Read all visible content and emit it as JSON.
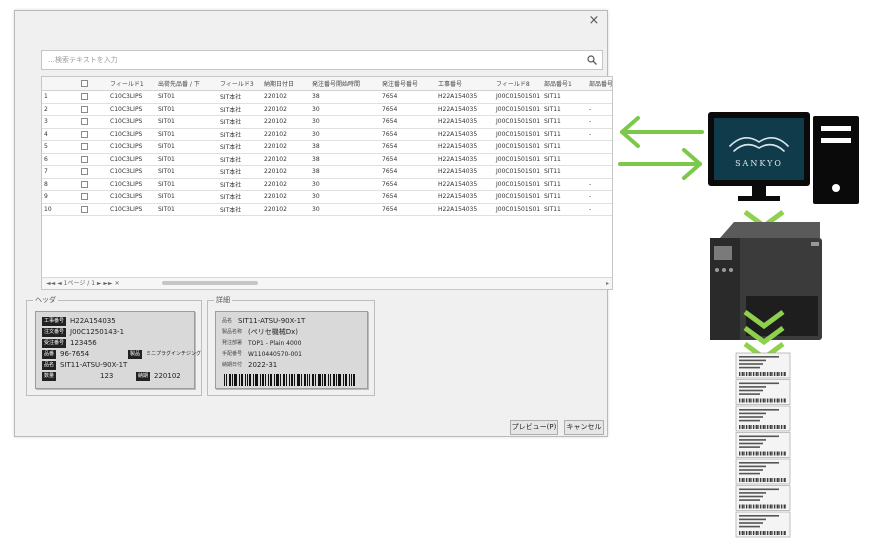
{
  "dialog": {
    "close_glyph": "×",
    "search_placeholder": "…検索テキストを入力",
    "columns": [
      "フィールド1",
      "出荷先品番 / 下",
      "フィールド3",
      "納期日付日",
      "発注番号開始時間",
      "発注番号番号",
      "工事番号",
      "フィールド8",
      "部品番号1",
      "部品番号"
    ],
    "rows": [
      {
        "no": "1",
        "cells": [
          "C10C3LIPS",
          "SIT01",
          "SIT本社",
          "220102",
          "38",
          "7654",
          "H22A154035",
          "J00C01501S01",
          "SIT11",
          ""
        ]
      },
      {
        "no": "2",
        "cells": [
          "C10C3LIPS",
          "SIT01",
          "SIT本社",
          "220102",
          "30",
          "7654",
          "H22A154035",
          "J00C01501S01",
          "SIT11",
          "-"
        ]
      },
      {
        "no": "3",
        "cells": [
          "C10C3LIPS",
          "SIT01",
          "SIT本社",
          "220102",
          "30",
          "7654",
          "H22A154035",
          "J00C01501S01",
          "SIT11",
          "-"
        ]
      },
      {
        "no": "4",
        "cells": [
          "C10C3LIPS",
          "SIT01",
          "SIT本社",
          "220102",
          "30",
          "7654",
          "H22A154035",
          "J00C01501S01",
          "SIT11",
          "-"
        ]
      },
      {
        "no": "5",
        "cells": [
          "C10C3LIPS",
          "SIT01",
          "SIT本社",
          "220102",
          "38",
          "7654",
          "H22A154035",
          "J00C01501S01",
          "SIT11",
          ""
        ]
      },
      {
        "no": "6",
        "cells": [
          "C10C3LIPS",
          "SIT01",
          "SIT本社",
          "220102",
          "38",
          "7654",
          "H22A154035",
          "J00C01501S01",
          "SIT11",
          ""
        ]
      },
      {
        "no": "7",
        "cells": [
          "C10C3LIPS",
          "SIT01",
          "SIT本社",
          "220102",
          "38",
          "7654",
          "H22A154035",
          "J00C01501S01",
          "SIT11",
          ""
        ]
      },
      {
        "no": "8",
        "cells": [
          "C10C3LIPS",
          "SIT01",
          "SIT本社",
          "220102",
          "30",
          "7654",
          "H22A154035",
          "J00C01501S01",
          "SIT11",
          "-"
        ]
      },
      {
        "no": "9",
        "cells": [
          "C10C3LIPS",
          "SIT01",
          "SIT本社",
          "220102",
          "30",
          "7654",
          "H22A154035",
          "J00C01501S01",
          "SIT11",
          "-"
        ]
      },
      {
        "no": "10",
        "cells": [
          "C10C3LIPS",
          "SIT01",
          "SIT本社",
          "220102",
          "30",
          "7654",
          "H22A154035",
          "J00C01501S01",
          "SIT11",
          "-"
        ]
      }
    ],
    "footer_text": "◄◄ ◄  1ページ / 1  ► ►► ✕",
    "header_group": {
      "title": "ヘッダ",
      "fields": [
        {
          "key": "工事番号",
          "value": "H22A154035"
        },
        {
          "key": "注文番号",
          "value": "J00C1250143-1"
        },
        {
          "key": "受注番号",
          "value": "123456"
        },
        {
          "key": "品番",
          "value": "96-7654"
        },
        {
          "key": "品名",
          "value": "SIT11-ATSU-90X-1T"
        },
        {
          "key": "数量",
          "value": "123"
        }
      ],
      "extra_key": "製品",
      "extra_value": "ミニプラグインチジング",
      "date_key": "納期",
      "date_value": "220102"
    },
    "detail_group": {
      "title": "詳細",
      "fields": [
        {
          "key": "品名",
          "value": "SIT11-ATSU-90X-1T"
        },
        {
          "key": "製品名称",
          "value": "(ペリセ機械Dx)"
        },
        {
          "key": "発注部署",
          "value": "TOP1 - Plain 4000"
        },
        {
          "key": "手配番号",
          "value": "W110440570-001"
        },
        {
          "key": "納期日付",
          "value": "2022-31"
        }
      ]
    },
    "preview_label": "プレビュー(P)",
    "cancel_label": "キャンセル"
  },
  "illustration": {
    "brand": "SANKYO",
    "arrow_color": "#7cc84a",
    "chevron_color": "#8fd14f",
    "monitor_screen_color": "#0f3b4a",
    "pc_color": "#0a0a0a"
  }
}
